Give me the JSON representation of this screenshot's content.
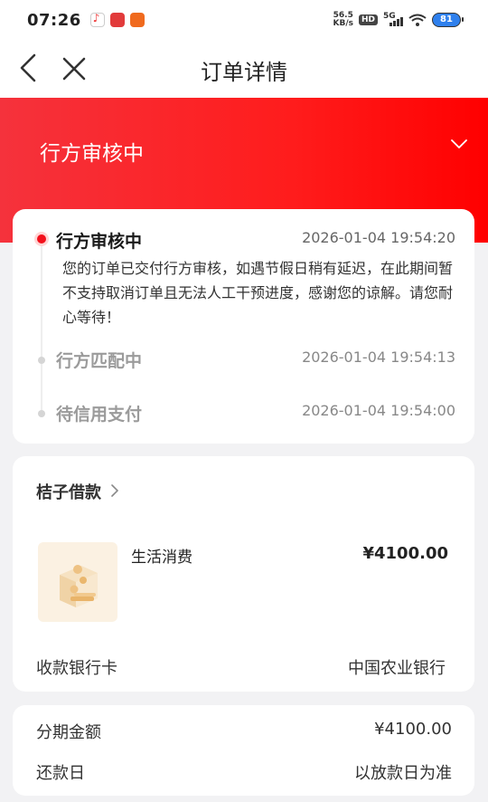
{
  "status_bar": {
    "time": "07:26",
    "net_speed_value": "56.5",
    "net_speed_unit": "KB/s",
    "hd_label": "HD",
    "network_label": "5G",
    "battery": "81"
  },
  "nav": {
    "title": "订单详情"
  },
  "banner": {
    "status_title": "行方审核中"
  },
  "timeline": {
    "steps": [
      {
        "title": "行方审核中",
        "time": "2026-01-04 19:54:20",
        "description": "您的订单已交付行方审核，如遇节假日稍有延迟，在此期间暂不支持取消订单且无法人工干预进度，感谢您的谅解。请您耐心等待！"
      },
      {
        "title": "行方匹配中",
        "time": "2026-01-04 19:54:13"
      },
      {
        "title": "待信用支付",
        "time": "2026-01-04 19:54:00"
      }
    ]
  },
  "loan": {
    "name": "桔子借款",
    "product_name": "生活消费",
    "product_price": "¥4100.00",
    "bank_label": "收款银行卡",
    "bank_value": "中国农业银行"
  },
  "summary": {
    "installment_label": "分期金额",
    "installment_value": "¥4100.00",
    "repay_label": "还款日",
    "repay_value": "以放款日为准"
  },
  "colors": {
    "accent_red": "#f3101b",
    "banner_start": "#f5323c",
    "banner_end": "#ff0000"
  }
}
